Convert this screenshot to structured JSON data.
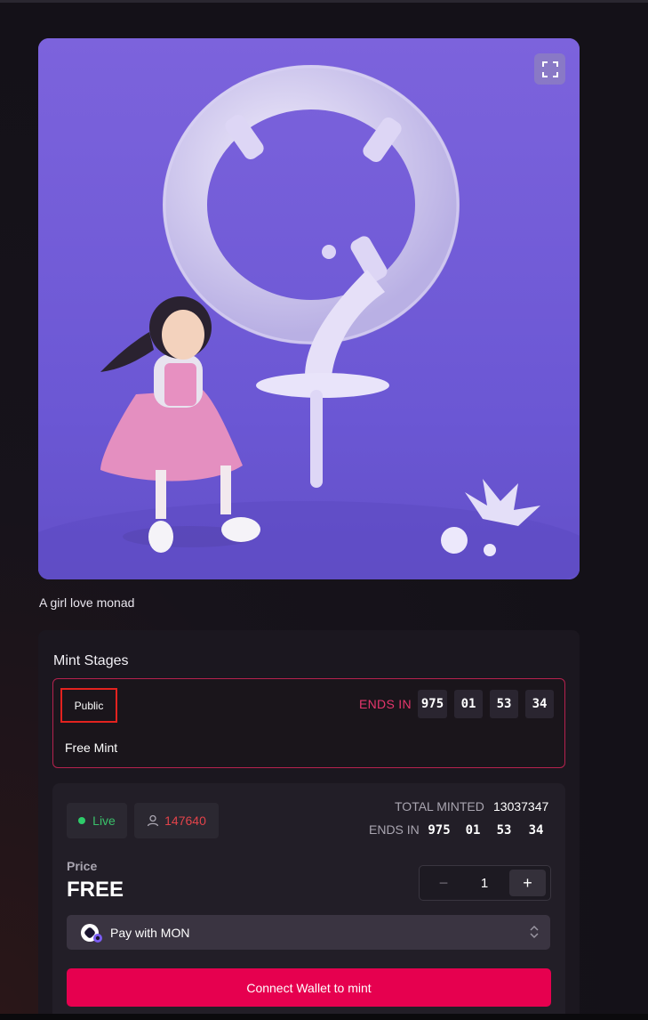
{
  "artwork": {
    "description_icon": "expand-icon",
    "caption": "A girl love monad"
  },
  "mint_stages": {
    "title": "Mint Stages",
    "stage": {
      "badge": "Public",
      "ends_label": "ENDS IN",
      "countdown": [
        "975",
        "01",
        "53",
        "34"
      ],
      "name": "Free Mint"
    }
  },
  "mint_box": {
    "status": "Live",
    "minters_icon": "user-icon",
    "minters": "147640",
    "total_minted_label": "TOTAL MINTED",
    "total_minted": "13037347",
    "ends_label": "ENDS IN",
    "countdown": [
      "975",
      "01",
      "53",
      "34"
    ],
    "price_label": "Price",
    "price": "FREE",
    "quantity": "1",
    "minus": "−",
    "plus": "+",
    "payment": {
      "icon": "monad-icon",
      "label": "Pay with MON"
    },
    "connect_button": "Connect Wallet to mint"
  },
  "colors": {
    "accent": "#e6004f",
    "live": "#3ac06a",
    "stage_border": "#b5224e",
    "ends_in": "#e5366c",
    "minters": "#e2434a"
  }
}
